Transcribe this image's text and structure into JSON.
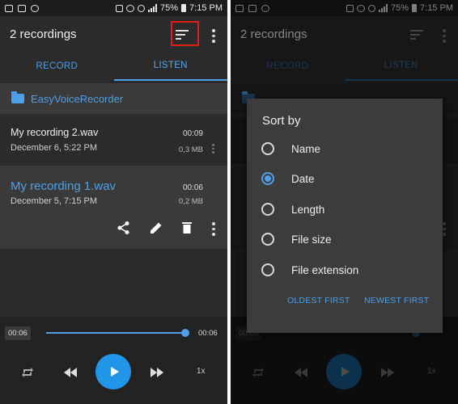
{
  "status_bar": {
    "battery": "75%",
    "time": "7:15 PM"
  },
  "app": {
    "title": "2 recordings"
  },
  "tabs": [
    {
      "label": "RECORD"
    },
    {
      "label": "LISTEN"
    }
  ],
  "folder": {
    "name": "EasyVoiceRecorder"
  },
  "recordings": [
    {
      "name": "My recording 2.wav",
      "date": "December 6, 5:22 PM",
      "duration": "00:09",
      "size": "0,3 MB"
    },
    {
      "name": "My recording 1.wav",
      "date": "December 5, 7:15 PM",
      "duration": "00:06",
      "size": "0,2 MB"
    }
  ],
  "player": {
    "current": "00:06",
    "total": "00:06",
    "speed": "1x",
    "progress": 1.0
  },
  "icons": [
    "sort-icon",
    "more-vert-icon",
    "folder-icon",
    "share-icon",
    "edit-icon",
    "delete-icon",
    "repeat-icon",
    "rewind-icon",
    "play-icon",
    "fast-forward-icon"
  ],
  "sort_dialog": {
    "title": "Sort by",
    "options": [
      {
        "label": "Name",
        "selected": false
      },
      {
        "label": "Date",
        "selected": true
      },
      {
        "label": "Length",
        "selected": false
      },
      {
        "label": "File size",
        "selected": false
      },
      {
        "label": "File extension",
        "selected": false
      }
    ],
    "buttons": {
      "oldest": "OLDEST FIRST",
      "newest": "NEWEST FIRST"
    }
  },
  "colors": {
    "accent": "#4f9fe6",
    "highlight": "#e41b1b",
    "background": "#2b2b2b",
    "play_button": "#2196e8"
  }
}
